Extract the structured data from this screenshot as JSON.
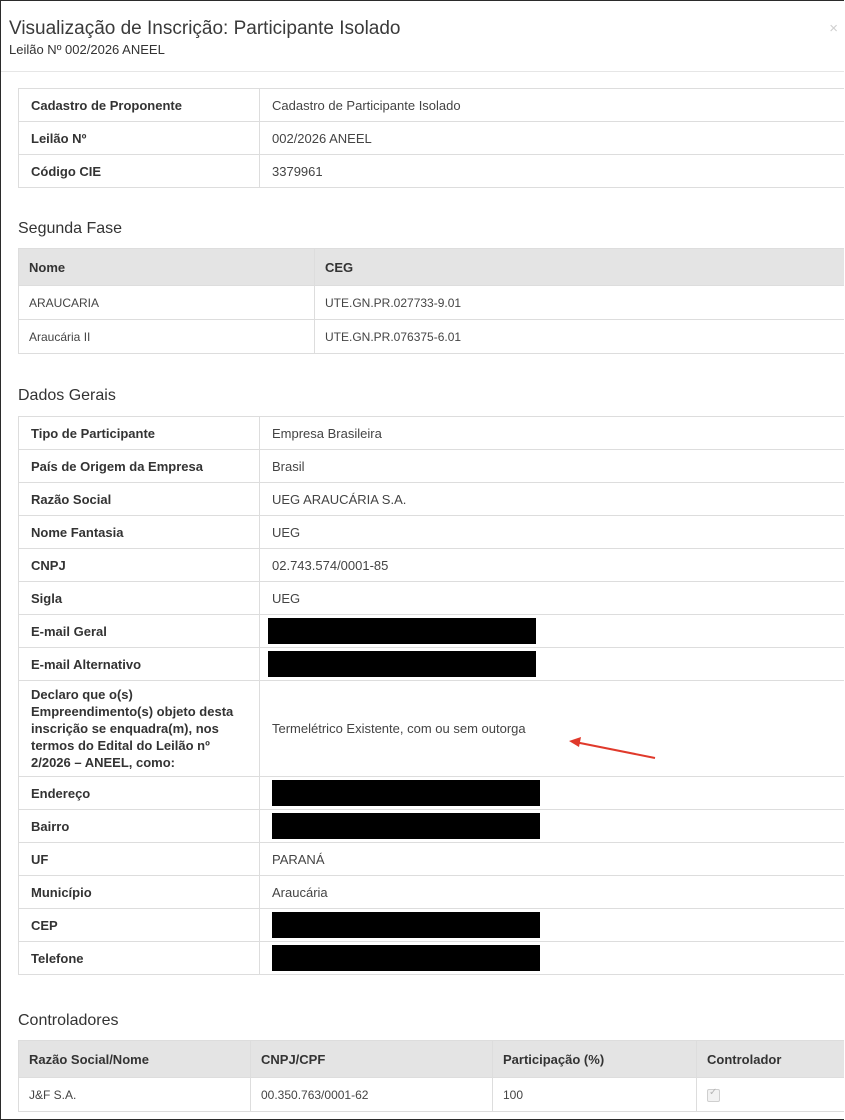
{
  "modal": {
    "title": "Visualização de Inscrição: Participante Isolado",
    "subtitle": "Leilão Nº 002/2026 ANEEL",
    "close_glyph": "×"
  },
  "summary": [
    {
      "label": "Cadastro de Proponente",
      "value": "Cadastro de Participante Isolado"
    },
    {
      "label": "Leilão Nº",
      "value": "002/2026 ANEEL"
    },
    {
      "label": "Código CIE",
      "value": "3379961"
    }
  ],
  "segunda_fase": {
    "title": "Segunda Fase",
    "headers": [
      "Nome",
      "CEG"
    ],
    "rows": [
      [
        "ARAUCARIA",
        "UTE.GN.PR.027733-9.01"
      ],
      [
        "Araucária II",
        "UTE.GN.PR.076375-6.01"
      ]
    ]
  },
  "dados_gerais": {
    "title": "Dados Gerais",
    "rows": [
      {
        "label": "Tipo de Participante",
        "value": "Empresa Brasileira"
      },
      {
        "label": "País de Origem da Empresa",
        "value": "Brasil"
      },
      {
        "label": "Razão Social",
        "value": "UEG ARAUCÁRIA S.A."
      },
      {
        "label": "Nome Fantasia",
        "value": "UEG"
      },
      {
        "label": "CNPJ",
        "value": "02.743.574/0001-85"
      },
      {
        "label": "Sigla",
        "value": "UEG"
      },
      {
        "label": "E-mail Geral",
        "value": ""
      },
      {
        "label": "E-mail Alternativo",
        "value": ""
      },
      {
        "label": "Declaro que o(s) Empreendimento(s) objeto desta inscrição se enquadra(m), nos termos do Edital do Leilão nº 2/2026 – ANEEL, como:",
        "value": "Termelétrico Existente, com ou sem outorga"
      },
      {
        "label": "Endereço",
        "value": ""
      },
      {
        "label": "Bairro",
        "value": ""
      },
      {
        "label": "UF",
        "value": "PARANÁ"
      },
      {
        "label": "Município",
        "value": "Araucária"
      },
      {
        "label": "CEP",
        "value": ""
      },
      {
        "label": "Telefone",
        "value": ""
      }
    ]
  },
  "controladores": {
    "title": "Controladores",
    "headers": [
      "Razão Social/Nome",
      "CNPJ/CPF",
      "Participação (%)",
      "Controlador"
    ],
    "rows": [
      {
        "nome": "J&F S.A.",
        "cnpj": "00.350.763/0001-62",
        "participacao": "100",
        "controlador": true
      }
    ]
  },
  "colors": {
    "annotation_arrow": "#e0392b",
    "redaction": "#000000",
    "table_header_bg": "#e4e4e4"
  }
}
